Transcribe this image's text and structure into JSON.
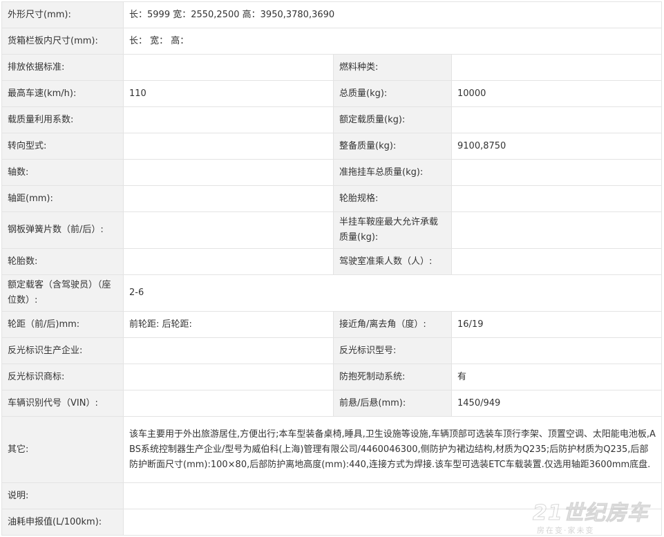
{
  "rows": [
    {
      "l1": "外形尺寸(mm):",
      "v1": "长：5999 宽：2550,2500 高：3950,3780,3690"
    },
    {
      "l1": "货箱栏板内尺寸(mm):",
      "v1": "长：  宽：  高："
    },
    {
      "l1": "排放依据标准:",
      "v1": "",
      "l2": "燃料种类:",
      "v2": ""
    },
    {
      "l1": "最高车速(km/h):",
      "v1": "110",
      "l2": "总质量(kg):",
      "v2": "10000"
    },
    {
      "l1": "载质量利用系数:",
      "v1": "",
      "l2": "额定载质量(kg):",
      "v2": ""
    },
    {
      "l1": "转向型式:",
      "v1": "",
      "l2": "整备质量(kg):",
      "v2": "9100,8750"
    },
    {
      "l1": "轴数:",
      "v1": "",
      "l2": "准拖挂车总质量(kg):",
      "v2": ""
    },
    {
      "l1": "轴距(mm):",
      "v1": "",
      "l2": "轮胎规格:",
      "v2": ""
    },
    {
      "l1": "钢板弹簧片数（前/后）:",
      "v1": "",
      "l2": "半挂车鞍座最大允许承载质量(kg):",
      "v2": ""
    },
    {
      "l1": "轮胎数:",
      "v1": "",
      "l2": "驾驶室准乘人数（人）:",
      "v2": ""
    },
    {
      "l1": "额定载客（含驾驶员）（座位数）:",
      "v1": "2-6"
    },
    {
      "l1": "轮距（前/后)mm:",
      "v1": "前轮距: 后轮距:",
      "l2": "接近角/离去角（度）:",
      "v2": "16/19"
    },
    {
      "l1": "反光标识生产企业:",
      "v1": "",
      "l2": "反光标识型号:",
      "v2": ""
    },
    {
      "l1": "反光标识商标:",
      "v1": "",
      "l2": "防抱死制动系统:",
      "v2": "有"
    },
    {
      "l1": "车辆识别代号（VIN）:",
      "v1": "",
      "l2": "前悬/后悬(mm):",
      "v2": "1450/949"
    },
    {
      "l1": "其它:",
      "v1": "该车主要用于外出旅游居住,方便出行;本车型装备桌椅,睡具,卫生设施等设施,车辆顶部可选装车顶行李架、顶置空调、太阳能电池板,ABS系统控制器生产企业/型号为威伯科(上海)管理有限公司/4460046300,侧防护为裙边结构,材质为Q235;后防护材质为Q235,后部防护断面尺寸(mm):100×80,后部防护离地高度(mm):440,连接方式为焊接.该车型可选装ETC车载装置.仅选用轴距3600mm底盘."
    },
    {
      "l1": "说明:",
      "v1": ""
    },
    {
      "l1": "油耗申报值(L/100km):",
      "v1": ""
    }
  ],
  "watermark": {
    "logo": "21世纪房车",
    "slogan": "房在变·家未变"
  }
}
